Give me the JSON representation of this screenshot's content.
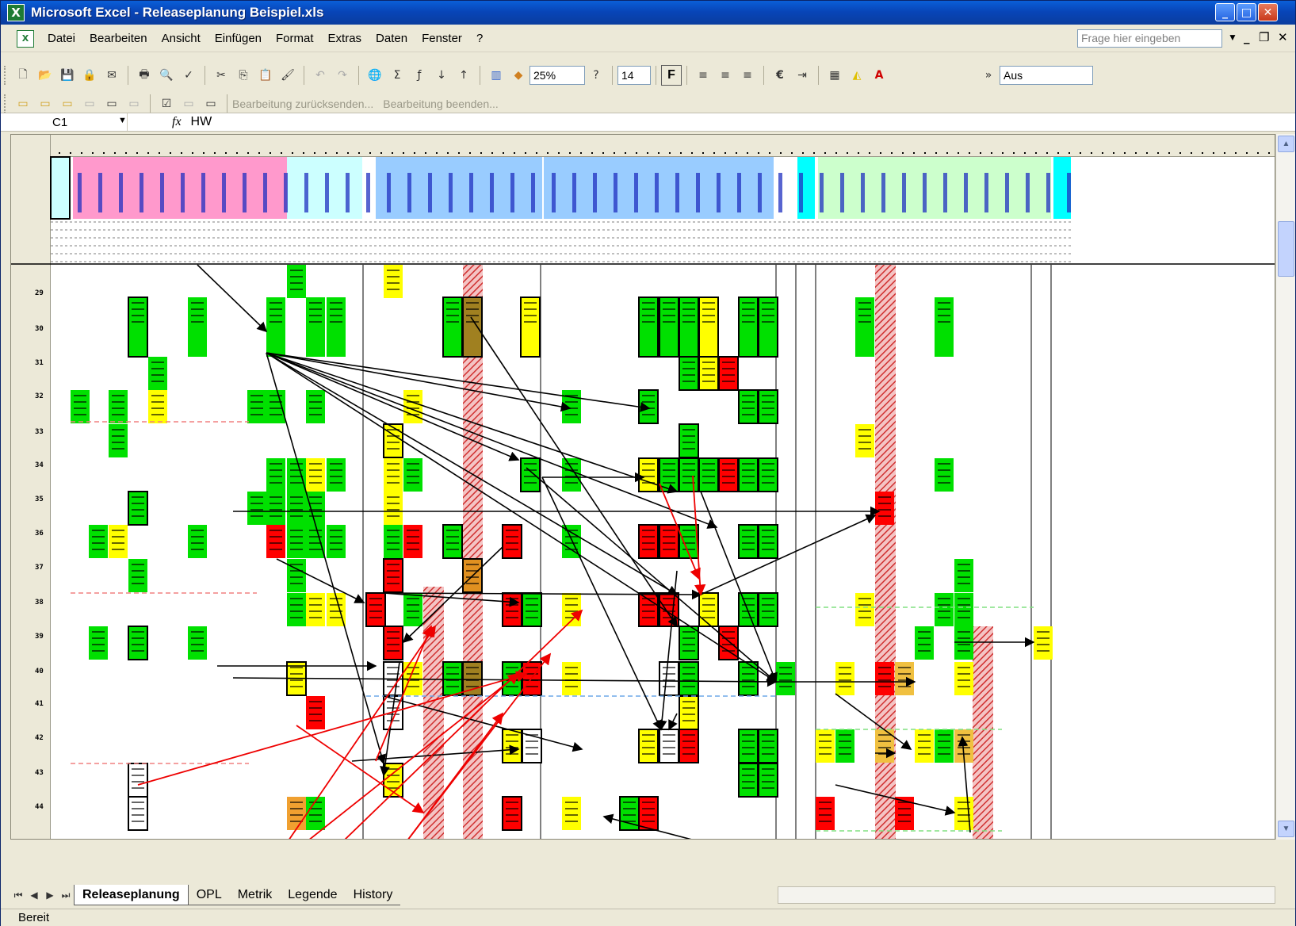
{
  "window": {
    "title": "Microsoft Excel - Releaseplanung Beispiel.xls",
    "app_icon": "X",
    "minimize": "_",
    "maximize": "□",
    "close": "✕"
  },
  "menubar": {
    "items": [
      "Datei",
      "Bearbeiten",
      "Ansicht",
      "Einfügen",
      "Format",
      "Extras",
      "Daten",
      "Fenster",
      "?"
    ],
    "ask_placeholder": "Frage hier eingeben"
  },
  "toolbar": {
    "zoom": "25%",
    "font_size": "14",
    "bold_label": "F",
    "currency": "€",
    "aus_label": "Aus",
    "review_send": "Bearbeitung zurücksenden...",
    "review_end": "Bearbeitung beenden..."
  },
  "formulabar": {
    "cell": "C1",
    "fx": "fx",
    "content": "HW"
  },
  "rows": [
    "29",
    "30",
    "31",
    "32",
    "33",
    "34",
    "35",
    "36",
    "37",
    "38",
    "39",
    "40",
    "41",
    "42",
    "43",
    "44"
  ],
  "sheet_tabs": [
    "Releaseplanung",
    "OPL",
    "Metrik",
    "Legende",
    "History"
  ],
  "active_tab": "Releaseplanung",
  "status": "Bereit",
  "colors": {
    "green": "#00e000",
    "yellow": "#ffff00",
    "red": "#ff0000",
    "pink": "#ff99cc",
    "lightblue": "#99ccff",
    "cyan": "#00ffff",
    "lightgreen": "#ccffcc",
    "paleblue": "#ccffff"
  }
}
